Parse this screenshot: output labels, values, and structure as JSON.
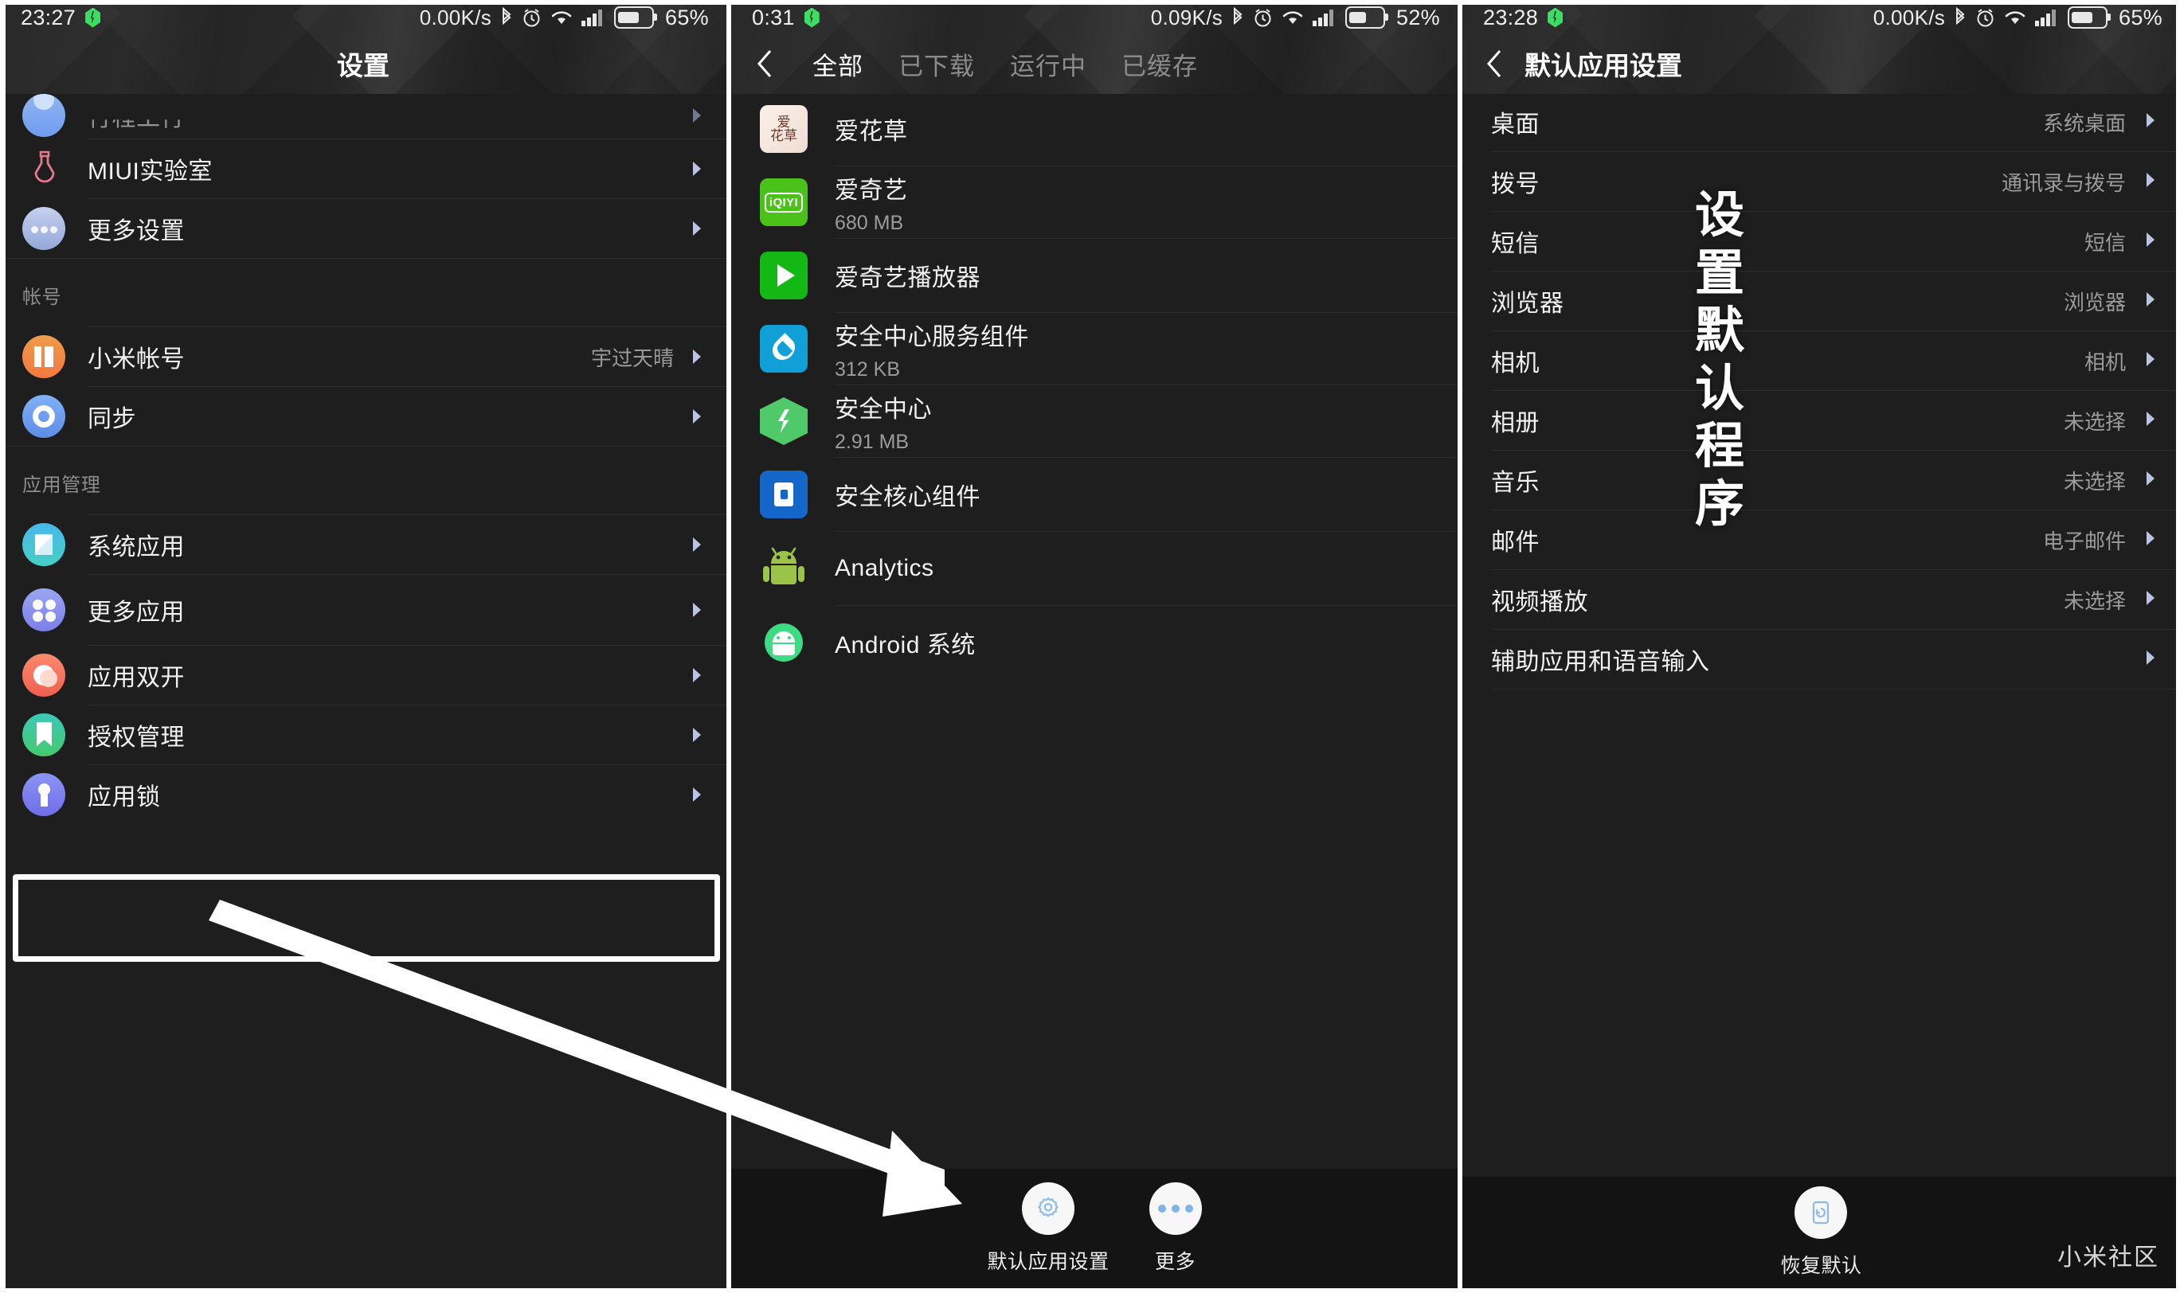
{
  "panel1": {
    "status": {
      "time": "23:27",
      "charge_icon": "green-gem-charging-icon",
      "net_speed": "0.00K/s",
      "bluetooth_icon": "bluetooth-icon",
      "alarm_icon": "alarm-icon",
      "wifi_icon": "wifi-icon",
      "signal_icon": "signal-icon",
      "battery_icon": "battery-icon",
      "battery_pct": "65%"
    },
    "header_title": "设置",
    "rows_top": [
      {
        "label": "行程工行",
        "icon": "partial-cut-icon",
        "value": "",
        "chevron": "chevron-right-icon"
      },
      {
        "label": "MIUI实验室",
        "icon": "flask-icon",
        "value": "",
        "chevron": "chevron-right-icon"
      },
      {
        "label": "更多设置",
        "icon": "more-dots-icon",
        "value": "",
        "chevron": "chevron-right-icon"
      }
    ],
    "group_account": "帐号",
    "rows_account": [
      {
        "label": "小米帐号",
        "icon": "mi-account-icon",
        "value": "宇过天晴",
        "chevron": "chevron-right-icon"
      },
      {
        "label": "同步",
        "icon": "sync-icon",
        "value": "",
        "chevron": "chevron-right-icon"
      }
    ],
    "group_apps": "应用管理",
    "rows_apps": [
      {
        "label": "系统应用",
        "icon": "system-apps-icon",
        "value": "",
        "chevron": "chevron-right-icon"
      },
      {
        "label": "更多应用",
        "icon": "more-apps-icon",
        "value": "",
        "chevron": "chevron-right-icon"
      },
      {
        "label": "应用双开",
        "icon": "dual-apps-icon",
        "value": "",
        "chevron": "chevron-right-icon"
      },
      {
        "label": "授权管理",
        "icon": "permissions-icon",
        "value": "",
        "chevron": "chevron-right-icon"
      },
      {
        "label": "应用锁",
        "icon": "app-lock-icon",
        "value": "",
        "chevron": "chevron-right-icon"
      }
    ],
    "highlighted_row": "更多应用"
  },
  "panel2": {
    "status": {
      "time": "0:31",
      "charge_icon": "green-gem-charging-icon",
      "net_speed": "0.09K/s",
      "bluetooth_icon": "bluetooth-icon",
      "alarm_icon": "alarm-icon",
      "wifi_icon": "wifi-icon",
      "signal_icon": "signal-icon",
      "battery_icon": "battery-icon",
      "battery_pct": "52%"
    },
    "back_icon": "back-chevron-icon",
    "tabs": [
      {
        "label": "全部",
        "active": true
      },
      {
        "label": "已下载",
        "active": false
      },
      {
        "label": "运行中",
        "active": false
      },
      {
        "label": "已缓存",
        "active": false
      }
    ],
    "apps": [
      {
        "name": "爱花草",
        "size": "",
        "icon": "aihuacao-icon"
      },
      {
        "name": "爱奇艺",
        "size": "680 MB",
        "icon": "iqiyi-icon"
      },
      {
        "name": "爱奇艺播放器",
        "size": "",
        "icon": "iqiyi-player-icon"
      },
      {
        "name": "安全中心服务组件",
        "size": "312 KB",
        "icon": "security-service-icon"
      },
      {
        "name": "安全中心",
        "size": "2.91 MB",
        "icon": "security-center-icon"
      },
      {
        "name": "安全核心组件",
        "size": "",
        "icon": "security-core-icon"
      },
      {
        "name": "Analytics",
        "size": "",
        "icon": "android-analytics-icon"
      },
      {
        "name": "Android 系统",
        "size": "",
        "icon": "android-system-icon"
      }
    ],
    "bottom_buttons": [
      {
        "label": "默认应用设置",
        "icon": "gear-icon"
      },
      {
        "label": "更多",
        "icon": "more-dots-icon"
      }
    ]
  },
  "panel3": {
    "status": {
      "time": "23:28",
      "charge_icon": "green-gem-charging-icon",
      "net_speed": "0.00K/s",
      "bluetooth_icon": "bluetooth-icon",
      "alarm_icon": "alarm-icon",
      "wifi_icon": "wifi-icon",
      "signal_icon": "signal-icon",
      "battery_icon": "battery-icon",
      "battery_pct": "65%"
    },
    "back_icon": "back-chevron-icon",
    "header_title": "默认应用设置",
    "rows": [
      {
        "label": "桌面",
        "value": "系统桌面",
        "chevron": "chevron-right-icon"
      },
      {
        "label": "拨号",
        "value": "通讯录与拨号",
        "chevron": "chevron-right-icon"
      },
      {
        "label": "短信",
        "value": "短信",
        "chevron": "chevron-right-icon"
      },
      {
        "label": "浏览器",
        "value": "浏览器",
        "chevron": "chevron-right-icon"
      },
      {
        "label": "相机",
        "value": "相机",
        "chevron": "chevron-right-icon"
      },
      {
        "label": "相册",
        "value": "未选择",
        "chevron": "chevron-right-icon"
      },
      {
        "label": "音乐",
        "value": "未选择",
        "chevron": "chevron-right-icon"
      },
      {
        "label": "邮件",
        "value": "电子邮件",
        "chevron": "chevron-right-icon"
      },
      {
        "label": "视频播放",
        "value": "未选择",
        "chevron": "chevron-right-icon"
      },
      {
        "label": "辅助应用和语音输入",
        "value": "",
        "chevron": "chevron-right-icon"
      }
    ],
    "restore_button": {
      "label": "恢复默认",
      "icon": "restore-icon"
    },
    "watermark": "小米社区",
    "overlay_text": [
      "设",
      "置",
      "默",
      "认",
      "程",
      "序"
    ]
  },
  "annotation": {
    "arrow": "pointing-arrow-from-more-apps-to-default-app-settings"
  },
  "colors": {
    "bg": "#1e1e1e",
    "text": "#f2f2f2",
    "muted": "#9b9b9b",
    "accent": "#7eb4e8",
    "highlight": "#ffffff",
    "charge": "#3ddc62"
  }
}
